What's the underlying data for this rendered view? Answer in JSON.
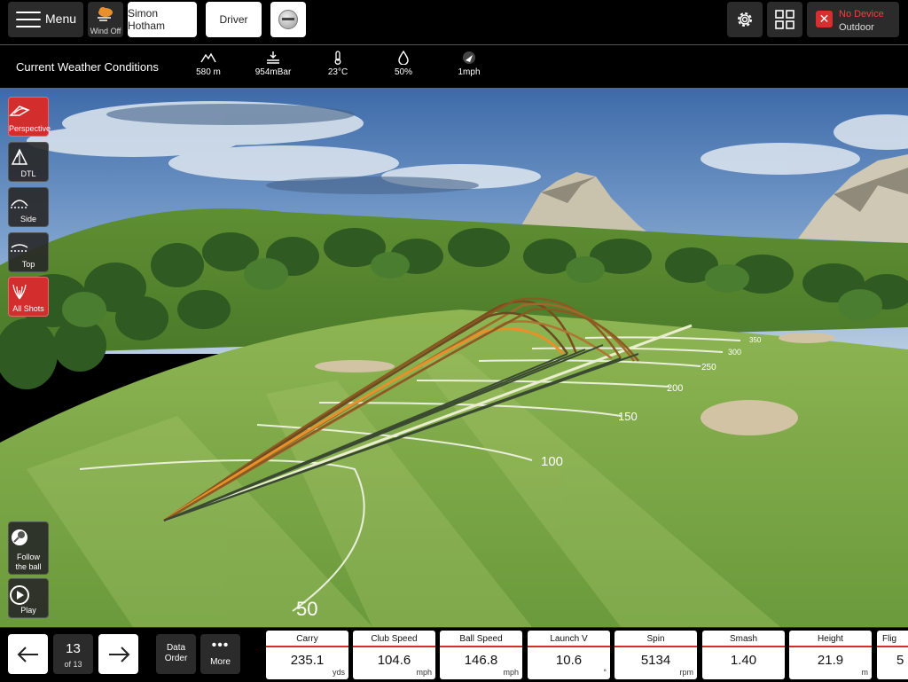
{
  "topbar": {
    "menu_label": "Menu",
    "wind_label": "Wind Off",
    "player_name": "Simon Hotham",
    "club_name": "Driver",
    "device_status": "No Device",
    "device_mode": "Outdoor"
  },
  "weather": {
    "title": "Current Weather Conditions",
    "items": [
      {
        "icon": "altitude-icon",
        "value": "580 m"
      },
      {
        "icon": "pressure-icon",
        "value": "954mBar"
      },
      {
        "icon": "thermometer-icon",
        "value": "23°C"
      },
      {
        "icon": "humidity-drop-icon",
        "value": "50%"
      },
      {
        "icon": "wind-direction-icon",
        "value": "1mph"
      }
    ]
  },
  "view_tools": [
    {
      "label": "Perspective",
      "active": true
    },
    {
      "label": "DTL",
      "active": false
    },
    {
      "label": "Side",
      "active": false
    },
    {
      "label": "Top",
      "active": false
    },
    {
      "label": "All Shots",
      "active": true
    }
  ],
  "camera_tools": {
    "follow_label_1": "Follow",
    "follow_label_2": "the ball",
    "play_label": "Play"
  },
  "distance_markers": [
    "50",
    "100",
    "150",
    "200",
    "250",
    "300",
    "350"
  ],
  "shot_nav": {
    "current": "13",
    "total_label": "of 13",
    "data_order_1": "Data",
    "data_order_2": "Order",
    "more_label": "More"
  },
  "metrics": [
    {
      "name": "Carry",
      "value": "235.1",
      "unit": "yds"
    },
    {
      "name": "Club Speed",
      "value": "104.6",
      "unit": "mph"
    },
    {
      "name": "Ball Speed",
      "value": "146.8",
      "unit": "mph"
    },
    {
      "name": "Launch V",
      "value": "10.6",
      "unit": "°"
    },
    {
      "name": "Spin",
      "value": "5134",
      "unit": "rpm"
    },
    {
      "name": "Smash",
      "value": "1.40",
      "unit": ""
    },
    {
      "name": "Height",
      "value": "21.9",
      "unit": "m"
    },
    {
      "name": "Flig",
      "value": "5",
      "unit": ""
    }
  ],
  "colors": {
    "accent_red": "#d42d2d",
    "trajectory_orange": "#e8902a",
    "trajectory_brown": "#8a5a22",
    "trajectory_dark": "#3a4a30"
  }
}
